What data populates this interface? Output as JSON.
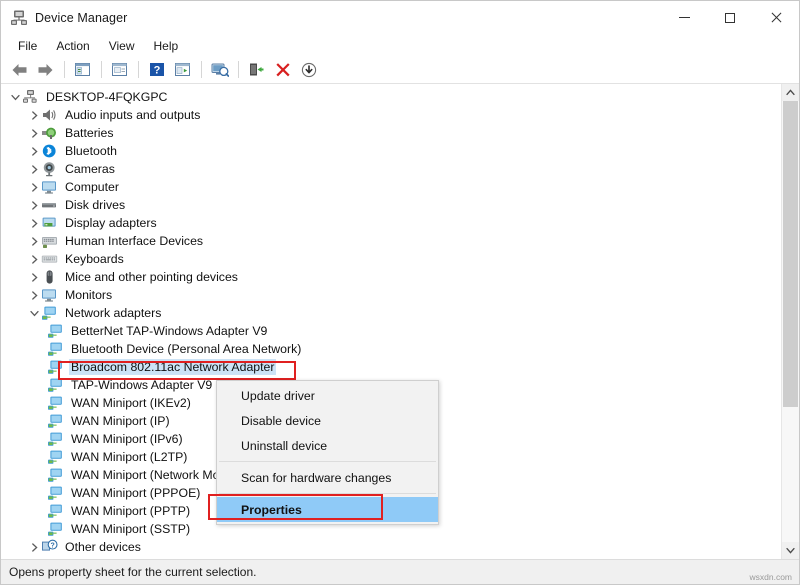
{
  "window": {
    "title": "Device Manager",
    "icon": "device-manager-icon",
    "controls": {
      "minimize": "–",
      "maximize": "□",
      "close": "✕"
    }
  },
  "menubar": {
    "items": [
      {
        "label": "File"
      },
      {
        "label": "Action"
      },
      {
        "label": "View"
      },
      {
        "label": "Help"
      }
    ]
  },
  "toolbar": {
    "buttons": [
      {
        "name": "back-arrow-icon",
        "title": "Back"
      },
      {
        "name": "forward-arrow-icon",
        "title": "Forward"
      },
      {
        "name": "show-hide-console-tree-icon",
        "title": "Show/Hide Console Tree"
      },
      {
        "name": "properties-icon",
        "title": "Properties"
      },
      {
        "name": "help-icon",
        "title": "Help"
      },
      {
        "name": "update-driver-icon",
        "title": "Update driver"
      },
      {
        "name": "scan-hardware-changes-icon",
        "title": "Scan for hardware changes"
      },
      {
        "name": "enable-device-icon",
        "title": "Enable device"
      },
      {
        "name": "uninstall-device-icon",
        "title": "Uninstall device"
      },
      {
        "name": "disable-device-icon",
        "title": "Disable device"
      }
    ]
  },
  "tree": {
    "root": {
      "label": "DESKTOP-4FQKGPC",
      "icon": "computer-root-icon",
      "expanded": true
    },
    "categories": [
      {
        "label": "Audio inputs and outputs",
        "icon": "speaker-icon",
        "expanded": false
      },
      {
        "label": "Batteries",
        "icon": "battery-icon",
        "expanded": false
      },
      {
        "label": "Bluetooth",
        "icon": "bluetooth-icon",
        "expanded": false
      },
      {
        "label": "Cameras",
        "icon": "camera-icon",
        "expanded": false
      },
      {
        "label": "Computer",
        "icon": "monitor-icon",
        "expanded": false
      },
      {
        "label": "Disk drives",
        "icon": "disk-drive-icon",
        "expanded": false
      },
      {
        "label": "Display adapters",
        "icon": "display-adapter-icon",
        "expanded": false
      },
      {
        "label": "Human Interface Devices",
        "icon": "hid-icon",
        "expanded": false
      },
      {
        "label": "Keyboards",
        "icon": "keyboard-icon",
        "expanded": false
      },
      {
        "label": "Mice and other pointing devices",
        "icon": "mouse-icon",
        "expanded": false
      },
      {
        "label": "Monitors",
        "icon": "monitor-icon",
        "expanded": false
      },
      {
        "label": "Network adapters",
        "icon": "network-adapter-icon",
        "expanded": true
      },
      {
        "label": "Other devices",
        "icon": "unknown-device-icon",
        "expanded": false
      }
    ],
    "network_adapters": [
      {
        "label": "BetterNet TAP-Windows Adapter V9",
        "icon": "network-adapter-icon",
        "selected": false
      },
      {
        "label": "Bluetooth Device (Personal Area Network)",
        "icon": "network-adapter-icon",
        "selected": false
      },
      {
        "label": "Broadcom 802.11ac Network Adapter",
        "icon": "network-adapter-icon",
        "selected": true
      },
      {
        "label": "TAP-Windows Adapter V9",
        "icon": "network-adapter-icon",
        "selected": false
      },
      {
        "label": "WAN Miniport (IKEv2)",
        "icon": "network-adapter-icon",
        "selected": false
      },
      {
        "label": "WAN Miniport (IP)",
        "icon": "network-adapter-icon",
        "selected": false
      },
      {
        "label": "WAN Miniport (IPv6)",
        "icon": "network-adapter-icon",
        "selected": false
      },
      {
        "label": "WAN Miniport (L2TP)",
        "icon": "network-adapter-icon",
        "selected": false
      },
      {
        "label": "WAN Miniport (Network Monitor)",
        "icon": "network-adapter-icon",
        "selected": false
      },
      {
        "label": "WAN Miniport (PPPOE)",
        "icon": "network-adapter-icon",
        "selected": false
      },
      {
        "label": "WAN Miniport (PPTP)",
        "icon": "network-adapter-icon",
        "selected": false
      },
      {
        "label": "WAN Miniport (SSTP)",
        "icon": "network-adapter-icon",
        "selected": false
      }
    ]
  },
  "context_menu": {
    "items": [
      {
        "label": "Update driver",
        "highlighted": false,
        "separator_after": false
      },
      {
        "label": "Disable device",
        "highlighted": false,
        "separator_after": false
      },
      {
        "label": "Uninstall device",
        "highlighted": false,
        "separator_after": true
      },
      {
        "label": "Scan for hardware changes",
        "highlighted": false,
        "separator_after": true
      },
      {
        "label": "Properties",
        "highlighted": true,
        "separator_after": false
      }
    ]
  },
  "statusbar": {
    "text": "Opens property sheet for the current selection."
  },
  "watermark": {
    "text": "wsxdn.com"
  },
  "colors": {
    "selection_blue": "#cce3f6",
    "menu_highlight_blue": "#8fcaf7",
    "annotation_red": "#e02020",
    "window_bg": "#ffffff",
    "statusbar_bg": "#f0f0f0"
  }
}
